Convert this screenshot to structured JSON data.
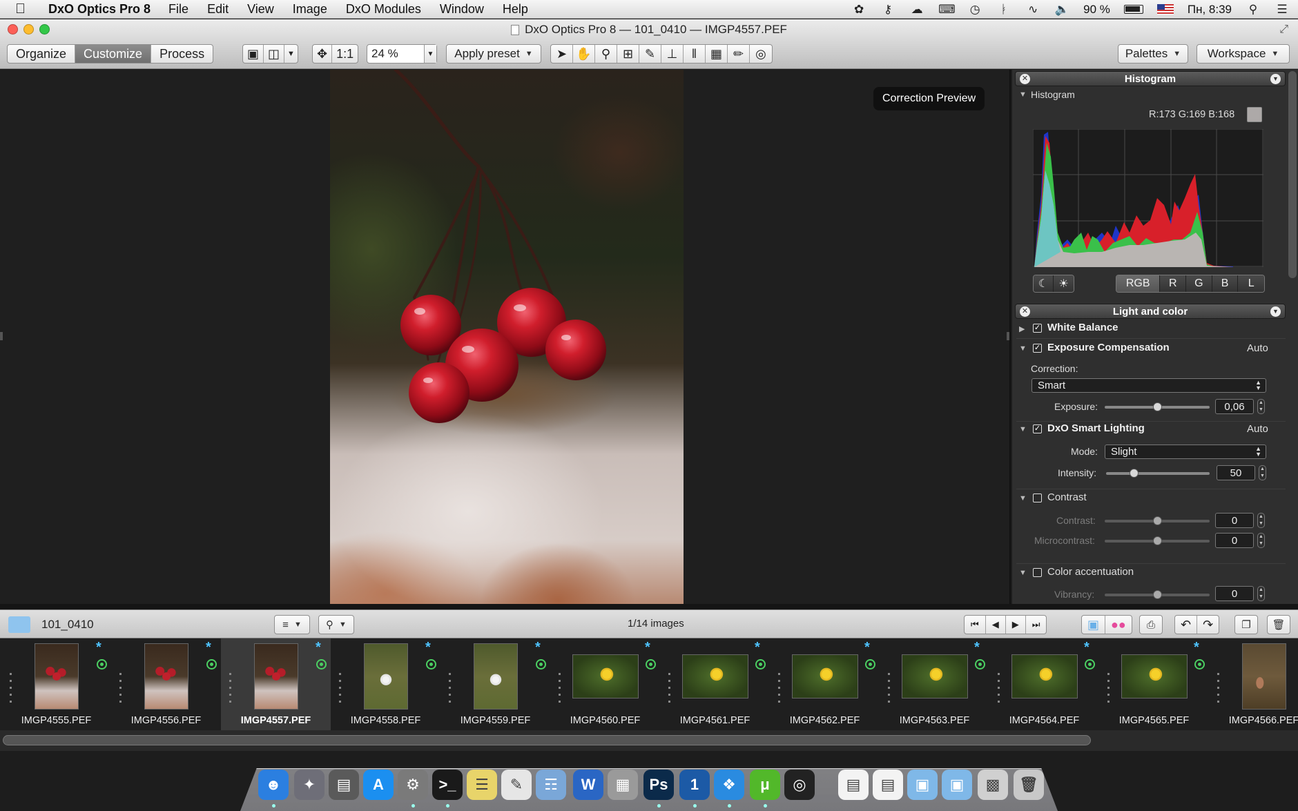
{
  "menubar": {
    "app_name": "DxO Optics Pro 8",
    "menus": [
      "File",
      "Edit",
      "View",
      "Image",
      "DxO Modules",
      "Window",
      "Help"
    ],
    "battery": "90 %",
    "clock": "Пн, 8:39"
  },
  "window": {
    "title": "DxO Optics Pro 8 — 101_0410 — IMGP4557.PEF"
  },
  "toolbar": {
    "tabs": [
      "Organize",
      "Customize",
      "Process"
    ],
    "active_tab": "Customize",
    "zoom_one": "1:1",
    "zoom_value": "24 %",
    "apply_preset": "Apply preset",
    "palettes": "Palettes",
    "workspace": "Workspace"
  },
  "viewer": {
    "correction_preview": "Correction Preview"
  },
  "histogram_palette": {
    "header": "Histogram",
    "section": "Histogram",
    "rgb_readout": "R:173 G:169 B:168",
    "swatch_color": "#ada9a8",
    "channels": [
      "RGB",
      "R",
      "G",
      "B",
      "L"
    ],
    "active_channel": "RGB"
  },
  "light_palette": {
    "header": "Light and color",
    "white_balance": "White Balance",
    "exposure": {
      "title": "Exposure Compensation",
      "auto": "Auto",
      "correction_label": "Correction:",
      "correction_value": "Smart",
      "exposure_label": "Exposure:",
      "exposure_value": "0,06"
    },
    "smart_lighting": {
      "title": "DxO Smart Lighting",
      "auto": "Auto",
      "mode_label": "Mode:",
      "mode_value": "Slight",
      "intensity_label": "Intensity:",
      "intensity_value": "50"
    },
    "contrast": {
      "title": "Contrast",
      "contrast_label": "Contrast:",
      "contrast_value": "0",
      "micro_label": "Microcontrast:",
      "micro_value": "0"
    },
    "color_accent": {
      "title": "Color accentuation",
      "vibrancy_label": "Vibrancy:",
      "vibrancy_value": "0"
    }
  },
  "filmbar": {
    "folder": "101_0410",
    "count": "1/14 images"
  },
  "filmstrip": {
    "selected": "IMGP4557.PEF",
    "thumbs": [
      {
        "name": "IMGP4555.PEF",
        "kind": "berries"
      },
      {
        "name": "IMGP4556.PEF",
        "kind": "berries"
      },
      {
        "name": "IMGP4557.PEF",
        "kind": "berries"
      },
      {
        "name": "IMGP4558.PEF",
        "kind": "white-flower"
      },
      {
        "name": "IMGP4559.PEF",
        "kind": "white-flower"
      },
      {
        "name": "IMGP4560.PEF",
        "kind": "yellow-flower"
      },
      {
        "name": "IMGP4561.PEF",
        "kind": "yellow-flower"
      },
      {
        "name": "IMGP4562.PEF",
        "kind": "yellow-flower"
      },
      {
        "name": "IMGP4563.PEF",
        "kind": "yellow-flower"
      },
      {
        "name": "IMGP4564.PEF",
        "kind": "yellow-flower"
      },
      {
        "name": "IMGP4565.PEF",
        "kind": "yellow-flower"
      },
      {
        "name": "IMGP4566.PEF",
        "kind": "mushroom"
      }
    ]
  },
  "dock": {
    "apps": [
      "finder-icon",
      "launchpad-icon",
      "system-info-icon",
      "app-store-icon",
      "system-preferences-icon",
      "terminal-icon",
      "stickies-icon",
      "textedit-icon",
      "preview-icon",
      "word-icon",
      "archive-utility-icon",
      "photoshop-icon",
      "1password-icon",
      "safari-icon",
      "utorrent-icon",
      "aperture-icon",
      "document-icon",
      "document-icon",
      "folder-icon",
      "folder-icon",
      "scanner-icon",
      "trash-icon"
    ]
  }
}
